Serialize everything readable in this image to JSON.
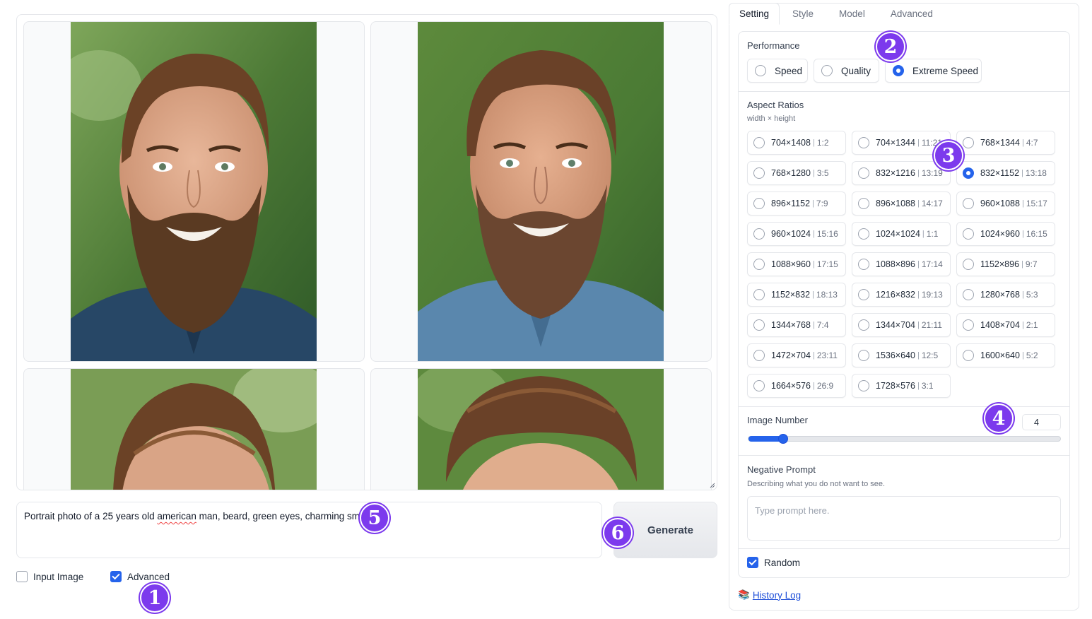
{
  "gallery": {
    "images": [
      {
        "alt": "portrait-1"
      },
      {
        "alt": "portrait-2"
      },
      {
        "alt": "portrait-3"
      },
      {
        "alt": "portrait-4"
      }
    ]
  },
  "prompt": {
    "text_before": "Portrait photo of a 25 years old ",
    "text_typo": "american",
    "text_after": " man, beard, green eyes, charming smile"
  },
  "generate": {
    "label": "Generate"
  },
  "checkboxes": {
    "input_image": {
      "label": "Input Image",
      "checked": false
    },
    "advanced": {
      "label": "Advanced",
      "checked": true
    }
  },
  "tabs": [
    {
      "label": "Setting",
      "active": true
    },
    {
      "label": "Style",
      "active": false
    },
    {
      "label": "Model",
      "active": false
    },
    {
      "label": "Advanced",
      "active": false
    }
  ],
  "performance": {
    "label": "Performance",
    "options": [
      {
        "label": "Speed",
        "selected": false
      },
      {
        "label": "Quality",
        "selected": false
      },
      {
        "label": "Extreme Speed",
        "selected": true
      }
    ]
  },
  "aspect_ratios": {
    "label": "Aspect Ratios",
    "sub": "width × height",
    "options": [
      {
        "size": "704×1408",
        "ratio": "1:2",
        "selected": false
      },
      {
        "size": "704×1344",
        "ratio": "11:21",
        "selected": false
      },
      {
        "size": "768×1344",
        "ratio": "4:7",
        "selected": false
      },
      {
        "size": "768×1280",
        "ratio": "3:5",
        "selected": false
      },
      {
        "size": "832×1216",
        "ratio": "13:19",
        "selected": false
      },
      {
        "size": "832×1152",
        "ratio": "13:18",
        "selected": true
      },
      {
        "size": "896×1152",
        "ratio": "7:9",
        "selected": false
      },
      {
        "size": "896×1088",
        "ratio": "14:17",
        "selected": false
      },
      {
        "size": "960×1088",
        "ratio": "15:17",
        "selected": false
      },
      {
        "size": "960×1024",
        "ratio": "15:16",
        "selected": false
      },
      {
        "size": "1024×1024",
        "ratio": "1:1",
        "selected": false
      },
      {
        "size": "1024×960",
        "ratio": "16:15",
        "selected": false
      },
      {
        "size": "1088×960",
        "ratio": "17:15",
        "selected": false
      },
      {
        "size": "1088×896",
        "ratio": "17:14",
        "selected": false
      },
      {
        "size": "1152×896",
        "ratio": "9:7",
        "selected": false
      },
      {
        "size": "1152×832",
        "ratio": "18:13",
        "selected": false
      },
      {
        "size": "1216×832",
        "ratio": "19:13",
        "selected": false
      },
      {
        "size": "1280×768",
        "ratio": "5:3",
        "selected": false
      },
      {
        "size": "1344×768",
        "ratio": "7:4",
        "selected": false
      },
      {
        "size": "1344×704",
        "ratio": "21:11",
        "selected": false
      },
      {
        "size": "1408×704",
        "ratio": "2:1",
        "selected": false
      },
      {
        "size": "1472×704",
        "ratio": "23:11",
        "selected": false
      },
      {
        "size": "1536×640",
        "ratio": "12:5",
        "selected": false
      },
      {
        "size": "1600×640",
        "ratio": "5:2",
        "selected": false
      },
      {
        "size": "1664×576",
        "ratio": "26:9",
        "selected": false
      },
      {
        "size": "1728×576",
        "ratio": "3:1",
        "selected": false
      }
    ]
  },
  "image_number": {
    "label": "Image Number",
    "value": "4",
    "slider_fraction": 0.11
  },
  "negative_prompt": {
    "label": "Negative Prompt",
    "sub": "Describing what you do not want to see.",
    "placeholder": "Type prompt here."
  },
  "random": {
    "label": "Random",
    "checked": true
  },
  "history": {
    "icon": "books-icon",
    "label": "History Log"
  },
  "badges": [
    "1",
    "2",
    "3",
    "4",
    "5",
    "6"
  ],
  "colors": {
    "accent": "#2563eb",
    "badge": "#7c3aed"
  }
}
